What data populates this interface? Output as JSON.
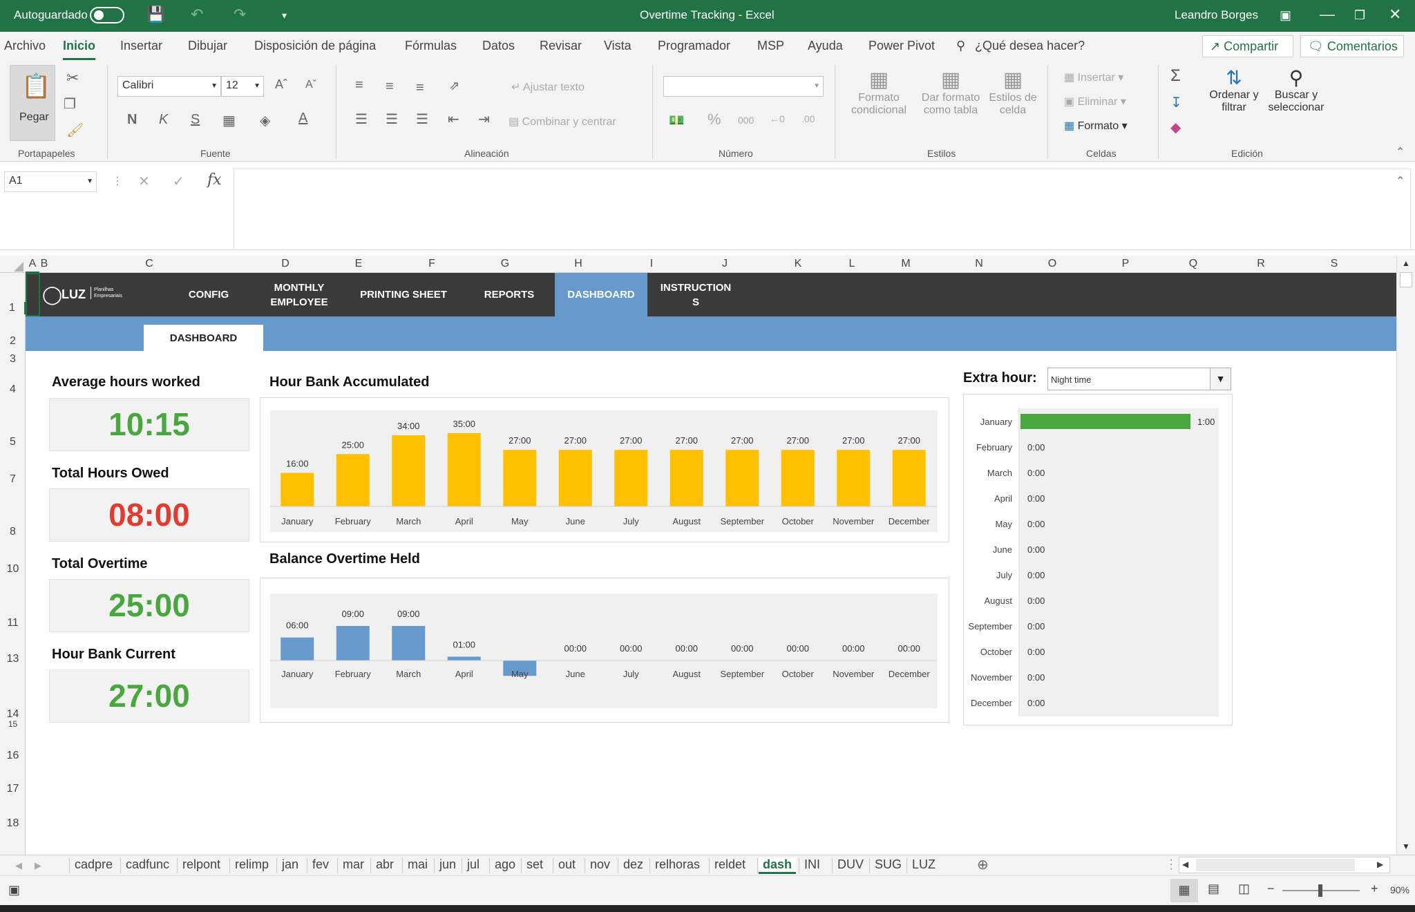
{
  "titlebar": {
    "autosave_label": "Autoguardado",
    "doc_title": "Overtime Tracking  -  Excel",
    "user": "Leandro Borges"
  },
  "menu": {
    "items": [
      "Archivo",
      "Inicio",
      "Insertar",
      "Dibujar",
      "Disposición de página",
      "Fórmulas",
      "Datos",
      "Revisar",
      "Vista",
      "Programador",
      "MSP",
      "Ayuda",
      "Power Pivot"
    ],
    "active": "Inicio",
    "search_placeholder": "¿Qué desea hacer?",
    "share_label": "Compartir",
    "comments_label": "Comentarios"
  },
  "ribbon": {
    "paste_label": "Pegar",
    "clipboard_group": "Portapapeles",
    "font_name": "Calibri",
    "font_size": "12",
    "font_group": "Fuente",
    "bold": "N",
    "italic": "K",
    "underline": "S",
    "wrap_text": "Ajustar texto",
    "merge_center": "Combinar y centrar",
    "alignment_group": "Alineación",
    "number_group": "Número",
    "cond_format_1": "Formato",
    "cond_format_2": "condicional",
    "format_table_1": "Dar formato",
    "format_table_2": "como tabla",
    "cell_styles_1": "Estilos de",
    "cell_styles_2": "celda",
    "styles_group": "Estilos",
    "insert": "Insertar",
    "delete": "Eliminar",
    "format": "Formato",
    "cells_group": "Celdas",
    "sort_1": "Ordenar y",
    "sort_2": "filtrar",
    "find_1": "Buscar y",
    "find_2": "seleccionar",
    "editing_group": "Edición"
  },
  "formula": {
    "name_box": "A1",
    "fx": "fx",
    "content": ""
  },
  "columns": [
    "A",
    "B",
    "C",
    "D",
    "E",
    "F",
    "G",
    "H",
    "I",
    "J",
    "K",
    "L",
    "M",
    "N",
    "O",
    "P",
    "Q",
    "R",
    "S"
  ],
  "rows": [
    "1",
    "2",
    "3",
    "4",
    "5",
    "7",
    "8",
    "10",
    "11",
    "13",
    "14",
    "15",
    "16",
    "17",
    "18"
  ],
  "nav": {
    "logo_text": "LUZ",
    "logo_sub_1": "Planilhas",
    "logo_sub_2": "Empresariais",
    "items": [
      "CONFIG",
      "MONTHLY EMPLOYEE",
      "PRINTING SHEET",
      "REPORTS",
      "DASHBOARD",
      "INSTRUCTION S"
    ],
    "active_index": 4,
    "sub_tab": "DASHBOARD"
  },
  "kpis": [
    {
      "title": "Average hours worked",
      "value": "10:15",
      "color": "#4aa63f"
    },
    {
      "title": "Total Hours Owed",
      "value": "08:00",
      "color": "#e03c31"
    },
    {
      "title": "Total Overtime",
      "value": "25:00",
      "color": "#4aa63f"
    },
    {
      "title": "Hour Bank Current",
      "value": "27:00",
      "color": "#4aa63f"
    }
  ],
  "extra_hour": {
    "label": "Extra hour:",
    "selected": "Night time"
  },
  "chart_data": [
    {
      "type": "bar",
      "title": "Hour Bank Accumulated",
      "categories": [
        "January",
        "February",
        "March",
        "April",
        "May",
        "June",
        "July",
        "August",
        "September",
        "October",
        "November",
        "December"
      ],
      "values": [
        16,
        25,
        34,
        35,
        27,
        27,
        27,
        27,
        27,
        27,
        27,
        27
      ],
      "labels": [
        "16:00",
        "25:00",
        "34:00",
        "35:00",
        "27:00",
        "27:00",
        "27:00",
        "27:00",
        "27:00",
        "27:00",
        "27:00",
        "27:00"
      ],
      "color": "#ffc000",
      "ylim": [
        0,
        35
      ]
    },
    {
      "type": "bar",
      "title": "Balance Overtime Held",
      "categories": [
        "January",
        "February",
        "March",
        "April",
        "May",
        "June",
        "July",
        "August",
        "September",
        "October",
        "November",
        "December"
      ],
      "values": [
        6,
        9,
        9,
        1,
        -4,
        0,
        0,
        0,
        0,
        0,
        0,
        0
      ],
      "labels": [
        "06:00",
        "09:00",
        "09:00",
        "01:00",
        "",
        "00:00",
        "00:00",
        "00:00",
        "00:00",
        "00:00",
        "00:00",
        "00:00"
      ],
      "color": "#6699cc",
      "ylim": [
        -4,
        9
      ]
    },
    {
      "type": "bar",
      "orientation": "horizontal",
      "categories": [
        "January",
        "February",
        "March",
        "April",
        "May",
        "June",
        "July",
        "August",
        "September",
        "October",
        "November",
        "December"
      ],
      "values": [
        1,
        0,
        0,
        0,
        0,
        0,
        0,
        0,
        0,
        0,
        0,
        0
      ],
      "labels": [
        "1:00",
        "0:00",
        "0:00",
        "0:00",
        "0:00",
        "0:00",
        "0:00",
        "0:00",
        "0:00",
        "0:00",
        "0:00",
        "0:00"
      ],
      "color": "#4aa63f",
      "xlim": [
        0,
        1
      ]
    }
  ],
  "sheet_tabs": [
    "cadpre",
    "cadfunc",
    "relpont",
    "relimp",
    "jan",
    "fev",
    "mar",
    "abr",
    "mai",
    "jun",
    "jul",
    "ago",
    "set",
    "out",
    "nov",
    "dez",
    "relhoras",
    "reldet",
    "dash",
    "INI",
    "DUV",
    "SUG",
    "LUZ"
  ],
  "active_sheet": "dash",
  "status": {
    "zoom": "90%"
  }
}
